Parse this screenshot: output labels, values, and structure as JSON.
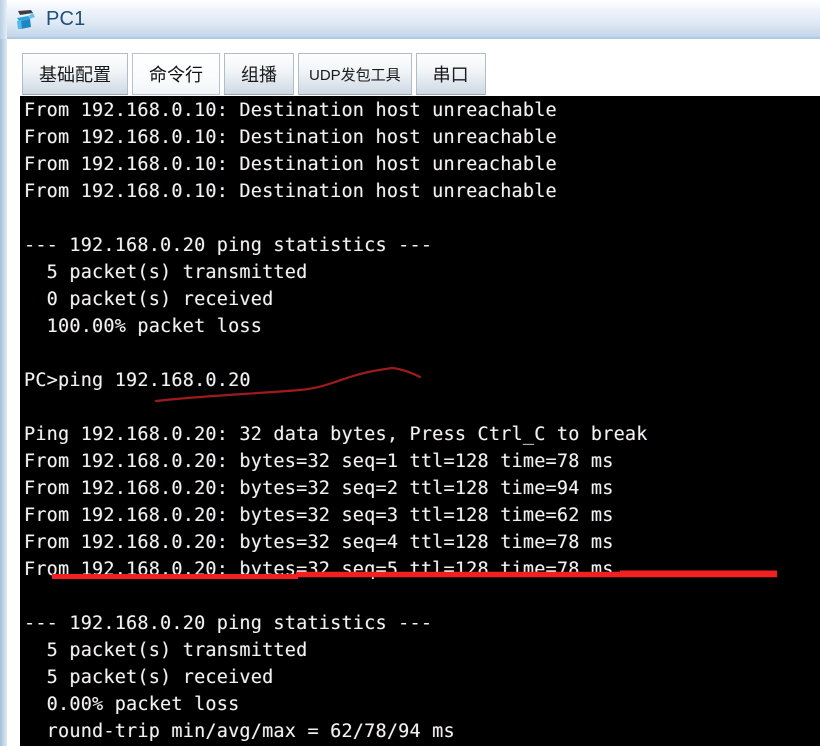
{
  "window": {
    "title": "PC1",
    "icon": "pc-device-icon",
    "title_color": "#1f4e79",
    "titlebar_gradient_top": "#ffffff",
    "titlebar_gradient_bottom": "#a8c3da"
  },
  "tabs": [
    {
      "id": "basic-config",
      "label": "基础配置",
      "active": false,
      "small": false
    },
    {
      "id": "command-line",
      "label": "命令行",
      "active": true,
      "small": false
    },
    {
      "id": "multicast",
      "label": "组播",
      "active": false,
      "small": false
    },
    {
      "id": "udp-packet-tool",
      "label": "UDP发包工具",
      "active": false,
      "small": true
    },
    {
      "id": "serial-port",
      "label": "串口",
      "active": false,
      "small": false
    }
  ],
  "terminal": {
    "background": "#000000",
    "foreground": "#f2f2f2",
    "lines": [
      "From 192.168.0.10: Destination host unreachable",
      "From 192.168.0.10: Destination host unreachable",
      "From 192.168.0.10: Destination host unreachable",
      "From 192.168.0.10: Destination host unreachable",
      "",
      "--- 192.168.0.20 ping statistics ---",
      "  5 packet(s) transmitted",
      "  0 packet(s) received",
      "  100.00% packet loss",
      "",
      "PC>ping 192.168.0.20",
      "",
      "Ping 192.168.0.20: 32 data bytes, Press Ctrl_C to break",
      "From 192.168.0.20: bytes=32 seq=1 ttl=128 time=78 ms",
      "From 192.168.0.20: bytes=32 seq=2 ttl=128 time=94 ms",
      "From 192.168.0.20: bytes=32 seq=3 ttl=128 time=62 ms",
      "From 192.168.0.20: bytes=32 seq=4 ttl=128 time=78 ms",
      "From 192.168.0.20: bytes=32 seq=5 ttl=128 time=78 ms",
      "",
      "--- 192.168.0.20 ping statistics ---",
      "  5 packet(s) transmitted",
      "  5 packet(s) received",
      "  0.00% packet loss",
      "  round-trip min/avg/max = 62/78/94 ms"
    ]
  },
  "annotations": {
    "squiggle_under_ping_command": {
      "color": "#9e1b1b",
      "target_text": "PC>ping 192.168.0.20"
    },
    "underline_under_seq5": {
      "color": "#f22020",
      "target_text": "From 192.168.0.20: bytes=32 seq=5 ttl=128 time=78 ms"
    }
  }
}
